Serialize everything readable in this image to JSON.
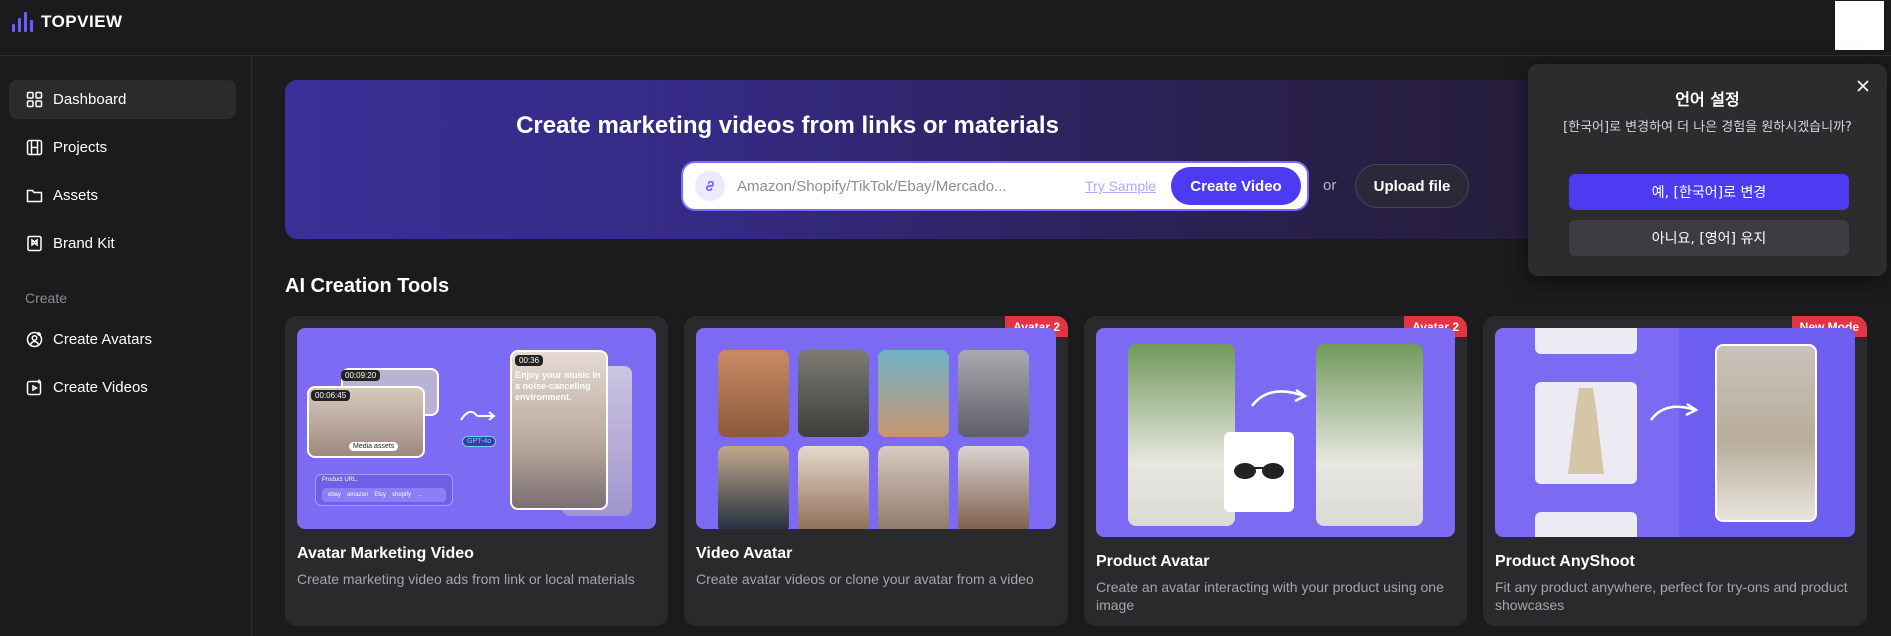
{
  "brand": {
    "name": "TOPVIEW",
    "accent": "#4c3bf0"
  },
  "sidebar": {
    "items": [
      {
        "label": "Dashboard",
        "icon": "grid-icon"
      },
      {
        "label": "Projects",
        "icon": "film-icon"
      },
      {
        "label": "Assets",
        "icon": "folder-icon"
      },
      {
        "label": "Brand Kit",
        "icon": "bookmark-icon"
      }
    ],
    "section_label": "Create",
    "create_items": [
      {
        "label": "Create Avatars",
        "icon": "user-plus-icon"
      },
      {
        "label": "Create Videos",
        "icon": "video-plus-icon"
      }
    ]
  },
  "hero": {
    "title": "Create marketing videos from links or materials",
    "placeholder": "Amazon/Shopify/TikTok/Ebay/Mercado...",
    "try_sample": "Try Sample",
    "create_button": "Create Video",
    "or_text": "or",
    "upload_button": "Upload file"
  },
  "tools": {
    "section_title": "AI Creation Tools",
    "cards": [
      {
        "title": "Avatar Marketing Video",
        "desc": "Create marketing video ads from link or local materials",
        "badge": ""
      },
      {
        "title": "Video Avatar",
        "desc": "Create avatar videos or clone your avatar from a video",
        "badge": "Avatar 2"
      },
      {
        "title": "Product Avatar",
        "desc": "Create an avatar interacting with your product using one image",
        "badge": "Avatar 2"
      },
      {
        "title": "Product AnyShoot",
        "desc": "Fit any product anywhere, perfect for try-ons and product showcases",
        "badge": "New Mode"
      }
    ],
    "thumb1": {
      "time1": "00:09:20",
      "time2": "00:06:45",
      "time3": "00:36",
      "caption": "Enjoy your music in a noise-canceling environment.",
      "media_label": "Media assets",
      "gpt_label": "GPT-4o",
      "url_label": "Product URL:",
      "platforms": [
        "ebay",
        "amazon",
        "Etsy",
        "shopify",
        "..."
      ]
    }
  },
  "language_popup": {
    "title": "언어 설정",
    "message": "[한국어]로 변경하여 더 나은 경험을 원하시겠습니까?",
    "confirm": "예, [한국어]로 변경",
    "decline": "아니요, [영어] 유지"
  }
}
